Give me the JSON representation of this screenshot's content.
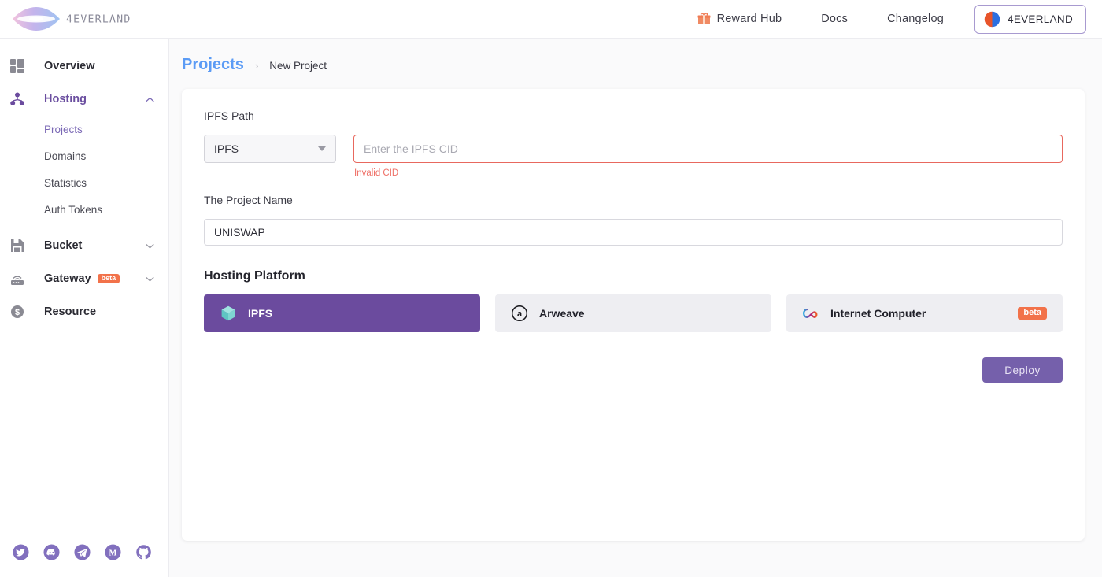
{
  "header": {
    "logo_text": "4EVERLAND",
    "nav": [
      {
        "label": "Reward Hub",
        "icon": "gift-icon"
      },
      {
        "label": "Docs",
        "icon": null
      },
      {
        "label": "Changelog",
        "icon": null
      }
    ],
    "user": {
      "name": "4EVERLAND",
      "avatar": "user-avatar"
    }
  },
  "sidebar": {
    "items": [
      {
        "label": "Overview",
        "icon": "dashboard-icon",
        "active": false,
        "expandable": false
      },
      {
        "label": "Hosting",
        "icon": "hosting-nodes-icon",
        "active": true,
        "expandable": true,
        "expanded": true
      },
      {
        "label": "Bucket",
        "icon": "floppy-disk-icon",
        "active": false,
        "expandable": true,
        "expanded": false
      },
      {
        "label": "Gateway",
        "icon": "router-icon",
        "active": false,
        "expandable": true,
        "expanded": false,
        "badge": "beta"
      },
      {
        "label": "Resource",
        "icon": "dollar-coin-icon",
        "active": false,
        "expandable": false
      }
    ],
    "hosting_children": [
      {
        "label": "Projects",
        "active": true
      },
      {
        "label": "Domains",
        "active": false
      },
      {
        "label": "Statistics",
        "active": false
      },
      {
        "label": "Auth Tokens",
        "active": false
      }
    ],
    "socials": [
      {
        "name": "twitter-icon"
      },
      {
        "name": "discord-icon"
      },
      {
        "name": "telegram-icon"
      },
      {
        "name": "medium-icon"
      },
      {
        "name": "github-icon"
      }
    ]
  },
  "breadcrumb": {
    "root": "Projects",
    "separator": "›",
    "current": "New Project"
  },
  "form": {
    "ipfs_path_label": "IPFS Path",
    "protocol_select": {
      "value": "IPFS"
    },
    "cid_input": {
      "value": "",
      "placeholder": "Enter the IPFS CID"
    },
    "cid_error": "Invalid CID",
    "project_name_label": "The Project Name",
    "project_name_value": "UNISWAP",
    "platform_title": "Hosting Platform",
    "platforms": [
      {
        "label": "IPFS",
        "icon": "ipfs-cube-icon",
        "selected": true,
        "badge": null
      },
      {
        "label": "Arweave",
        "icon": "arweave-icon",
        "selected": false,
        "badge": null
      },
      {
        "label": "Internet Computer",
        "icon": "internet-computer-icon",
        "selected": false,
        "badge": "beta"
      }
    ],
    "deploy_label": "Deploy"
  },
  "colors": {
    "brand_purple": "#6b4b9e",
    "accent_blue": "#5b9bf5",
    "error_red": "#e8685e",
    "beta_orange": "#f2724a",
    "deploy_purple": "#7560ab"
  }
}
